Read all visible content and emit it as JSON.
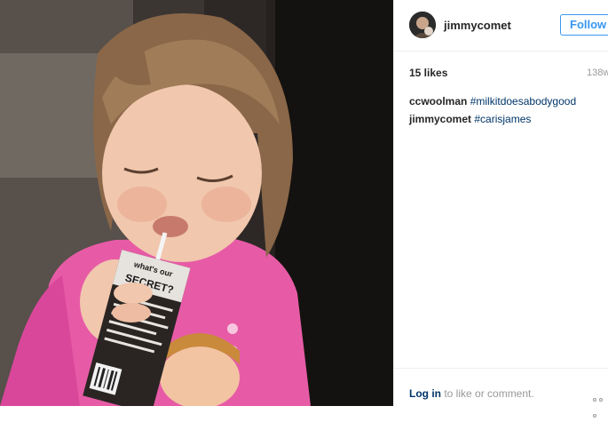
{
  "post": {
    "photo_description_icon": "photo-icon",
    "carton": {
      "line1": "what's our",
      "line2": "SECRET?"
    }
  },
  "header": {
    "username": "jimmycomet",
    "follow_label": "Follow"
  },
  "meta": {
    "likes": "15 likes",
    "timestamp": "138w"
  },
  "comments": [
    {
      "author": "ccwoolman",
      "text": "#milkitdoesabodygood"
    },
    {
      "author": "jimmycomet",
      "text": "#carisjames"
    }
  ],
  "footer": {
    "login_link": "Log in",
    "login_text": " to like or comment.",
    "more_icon": "more-options-icon"
  },
  "colors": {
    "link_blue": "#3897f0",
    "hashtag_blue": "#003569",
    "muted_gray": "#999999"
  }
}
